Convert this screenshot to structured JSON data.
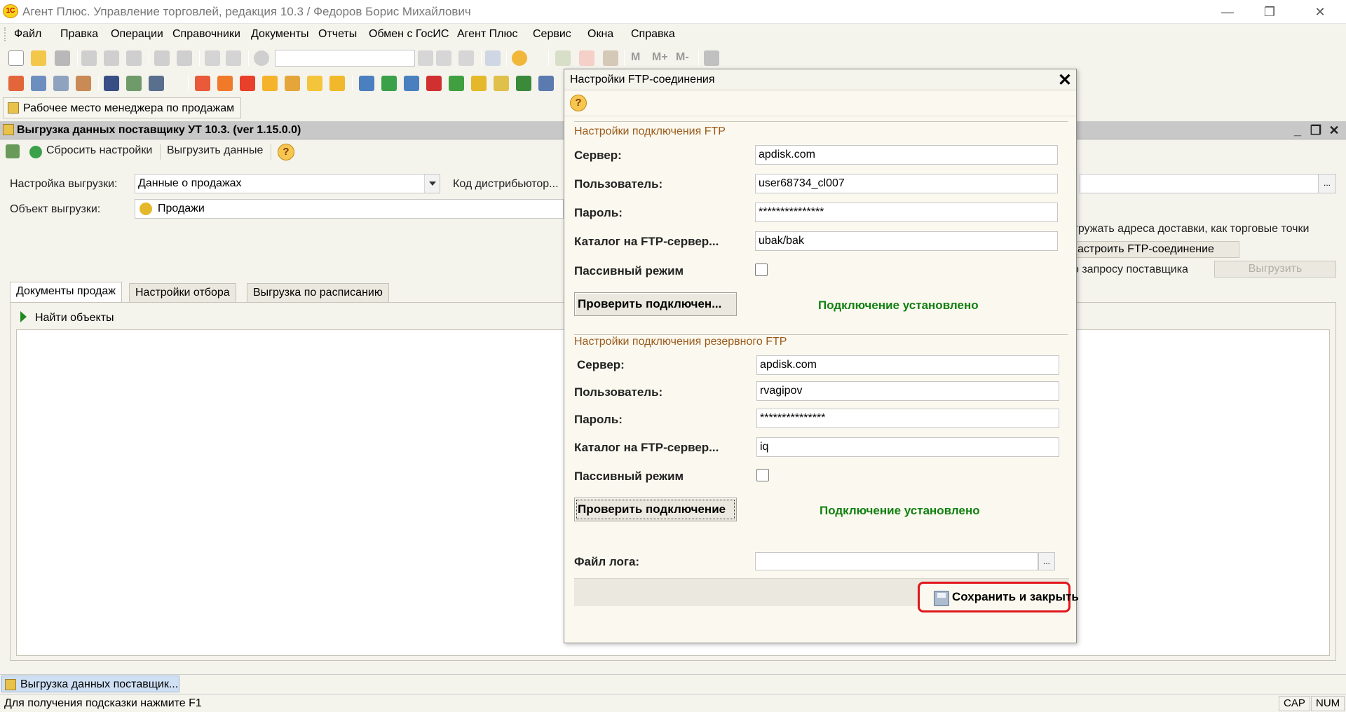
{
  "window": {
    "logo": "1С",
    "title": "Агент Плюс. Управление торговлей, редакция 10.3 / Федоров Борис Михайлович",
    "minimize": "—",
    "restore": "❐",
    "close": "✕"
  },
  "menu": {
    "items": [
      "Файл",
      "Правка",
      "Операции",
      "Справочники",
      "Документы",
      "Отчеты",
      "Обмен с ГосИС",
      "Агент Плюс",
      "Сервис",
      "Окна",
      "Справка"
    ]
  },
  "toolbar": {
    "m_label": "M",
    "m_plus_label": "M+",
    "m_minus_label": "M-"
  },
  "panel": {
    "button_label": "Рабочее место менеджера по продажам"
  },
  "mdi": {
    "title": "Выгрузка данных поставщику УТ 10.3. (ver 1.15.0.0)",
    "min": "_",
    "restore": "❐",
    "close": "✕",
    "commands": {
      "reset": "Сбросить настройки",
      "export": "Выгрузить данные",
      "help": "?"
    },
    "fields": {
      "setting_label": "Настройка выгрузки:",
      "setting_value": "Данные о продажах",
      "distributor_label": "Код дистрибьютор...",
      "object_label": "Объект выгрузки:",
      "object_value": "Продажи"
    },
    "right": {
      "delivery_text": "гружать адреса доставки, как торговые точки",
      "ftp_button": "астроить FTP-соединение",
      "supplier_text": "о запросу поставщика",
      "upload_button": "Выгрузить"
    },
    "tabs": [
      {
        "label": "Документы продаж",
        "active": true
      },
      {
        "label": "Настройки отбора",
        "active": false
      },
      {
        "label": "Выгрузка по расписанию",
        "active": false
      }
    ],
    "find_objects": "Найти объекты"
  },
  "taskbar": {
    "item": "Выгрузка данных поставщик..."
  },
  "status": {
    "message": "Для получения подсказки нажмите F1",
    "cap": "CAP",
    "num": "NUM"
  },
  "dialog": {
    "title": "Настройки FTP-соединения",
    "close": "✕",
    "help": "?",
    "primary": {
      "group_title": "Настройки подключения FTP",
      "server_label": "Сервер:",
      "server_value": "apdisk.com",
      "user_label": "Пользователь:",
      "user_value": "user68734_cl007",
      "password_label": "Пароль:",
      "password_value": "***************",
      "catalog_label": "Каталог на FTP-сервер...",
      "catalog_value": "ubak/bak",
      "passive_label": "Пассивный режим",
      "passive_checked": false,
      "check_button": "Проверить подключен...",
      "status": "Подключение установлено"
    },
    "backup": {
      "group_title": "Настройки подключения резервного FTP",
      "server_label": "Сервер:",
      "server_value": "apdisk.com",
      "user_label": "Пользователь:",
      "user_value": "rvagipov",
      "password_label": "Пароль:",
      "password_value": "***************",
      "catalog_label": "Каталог на FTP-сервер...",
      "catalog_value": "iq",
      "passive_label": "Пассивный режим",
      "passive_checked": false,
      "check_button": "Проверить подключение",
      "status": "Подключение установлено"
    },
    "log_label": "Файл лога:",
    "log_value": "",
    "ellipsis": "...",
    "save_button": "Сохранить и закрыть"
  },
  "colors": {
    "status_ok": "#118011",
    "group_title": "#9a5a1b",
    "highlight": "#e0151c"
  }
}
